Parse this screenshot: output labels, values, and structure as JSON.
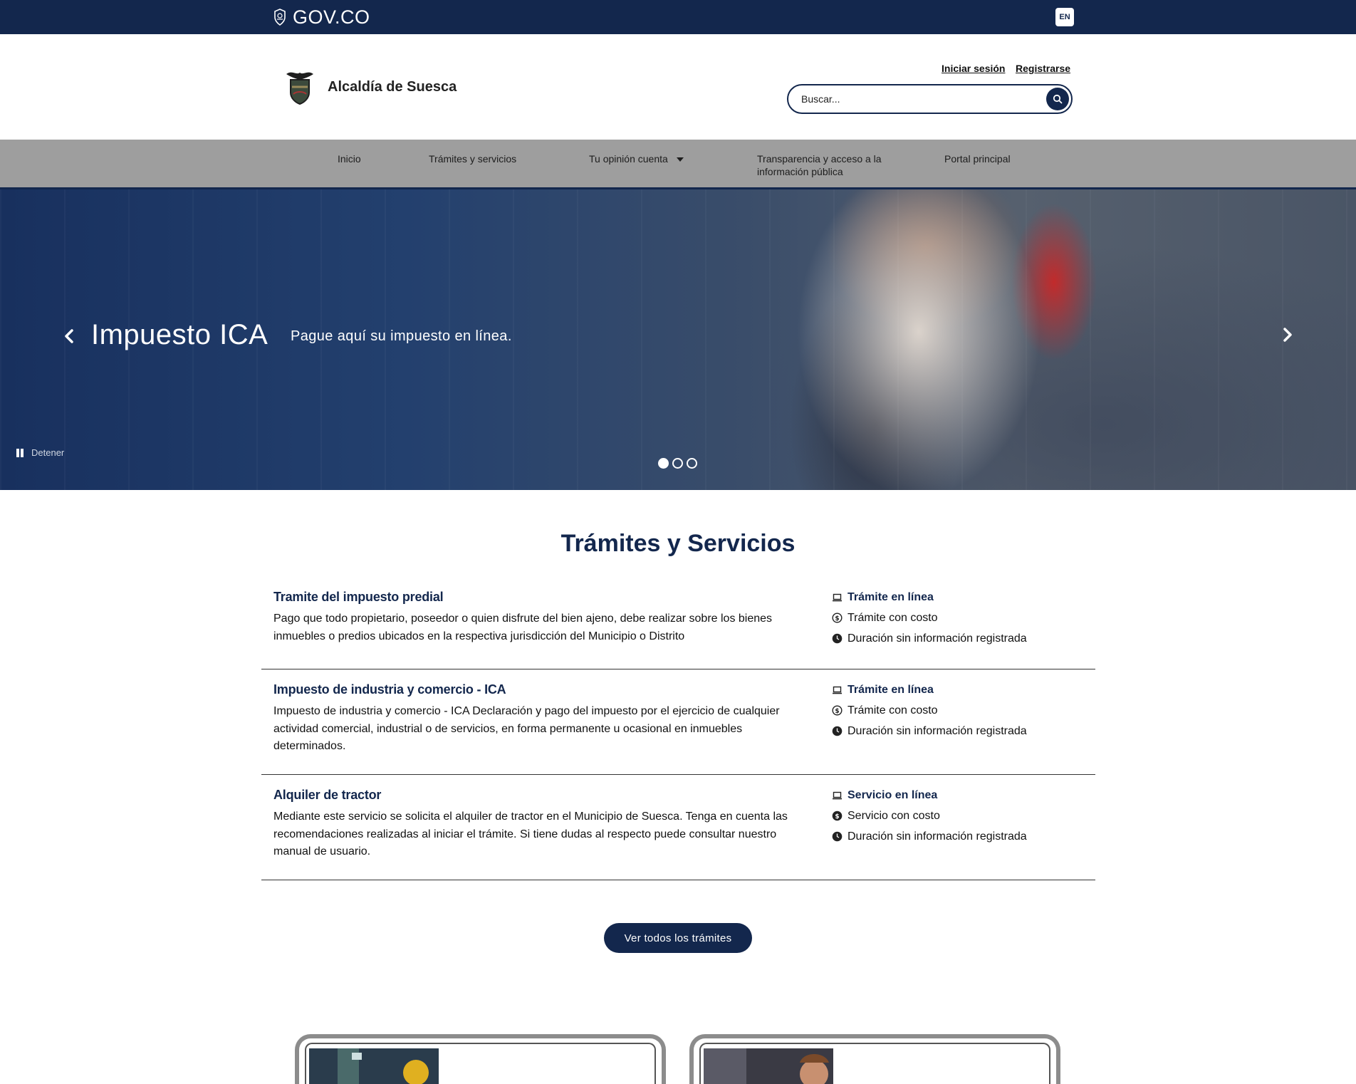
{
  "govbar": {
    "logo_text": "GOV.CO",
    "lang_label": "EN"
  },
  "header": {
    "brand_name": "Alcaldía de Suesca",
    "login_label": "Iniciar sesión",
    "register_label": "Registrarse",
    "search_placeholder": "Buscar..."
  },
  "nav": {
    "items": [
      {
        "label": "Inicio"
      },
      {
        "label": "Trámites y servicios"
      },
      {
        "label": "Tu opinión cuenta"
      },
      {
        "label": "Transparencia y acceso a la información pública"
      },
      {
        "label": "Portal principal"
      }
    ]
  },
  "hero": {
    "title": "Impuesto ICA",
    "subtitle": "Pague aquí su impuesto en línea.",
    "pause_label": "Detener",
    "slide_count": 3,
    "active_slide": 1
  },
  "section": {
    "title": "Trámites y Servicios",
    "items": [
      {
        "name": "Tramite del impuesto predial",
        "description": "Pago que todo propietario, poseedor o quien disfrute del bien ajeno, debe realizar sobre los bienes inmuebles o predios ubicados en la respectiva jurisdicción del Municipio o Distrito",
        "mode": "Trámite en línea",
        "cost": "Trámite con costo",
        "duration": "Duración sin información registrada"
      },
      {
        "name": "Impuesto de industria y comercio - ICA",
        "description": "Impuesto de industria y comercio - ICA Declaración y pago del impuesto por el ejercicio de cualquier actividad comercial, industrial o de servicios, en forma permanente u ocasional en inmuebles determinados.",
        "mode": "Trámite en línea",
        "cost": "Trámite con costo",
        "duration": "Duración sin información registrada"
      },
      {
        "name": "Alquiler de tractor",
        "description": "Mediante este servicio se solicita el alquiler de tractor en el Municipio de Suesca. Tenga en cuenta las recomendaciones realizadas al iniciar el trámite. Si tiene dudas al respecto puede consultar nuestro manual de usuario.",
        "mode": "Servicio en línea",
        "cost": "Servicio con costo",
        "duration": "Duración sin información registrada"
      }
    ],
    "all_button_label": "Ver todos los trámites"
  },
  "colors": {
    "primary": "#13274d",
    "nav_bg": "#9e9e9e",
    "white": "#ffffff"
  }
}
